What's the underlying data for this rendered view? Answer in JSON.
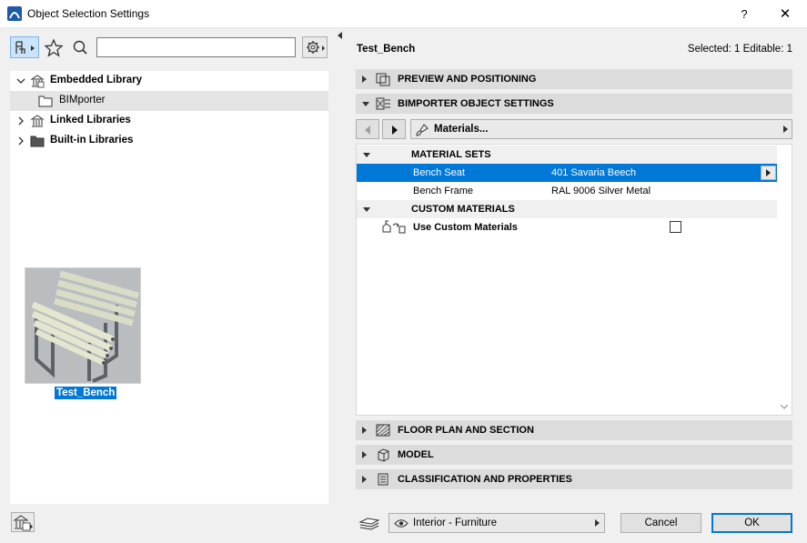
{
  "window": {
    "title": "Object Selection Settings",
    "help_glyph": "?",
    "close_glyph": "✕"
  },
  "library_tree": {
    "items": [
      {
        "label": "Embedded Library",
        "expanded": true,
        "icon": "library-icon"
      },
      {
        "label": "BIMporter",
        "icon": "folder-icon",
        "selected": true
      },
      {
        "label": "Linked Libraries",
        "expanded": false,
        "icon": "library-icon"
      },
      {
        "label": "Built-in Libraries",
        "expanded": false,
        "icon": "folder-filled-icon"
      }
    ]
  },
  "search": {
    "value": "",
    "placeholder": ""
  },
  "preview": {
    "thumbnail_label": "Test_Bench"
  },
  "header": {
    "object_name": "Test_Bench",
    "selection_info": "Selected: 1 Editable: 1"
  },
  "sections": {
    "preview_positioning": "PREVIEW AND POSITIONING",
    "bimporter_settings": "BIMPORTER OBJECT SETTINGS",
    "floor_plan_section": "FLOOR PLAN AND SECTION",
    "model": "MODEL",
    "classification": "CLASSIFICATION AND PROPERTIES"
  },
  "page_nav": {
    "current_page": "Materials..."
  },
  "properties": {
    "material_sets_group": "MATERIAL SETS",
    "rows": [
      {
        "name": "Bench Seat",
        "value": "401 Savaria Beech"
      },
      {
        "name": "Bench Frame",
        "value": "RAL 9006 Silver Metal"
      }
    ],
    "custom_materials_group": "CUSTOM MATERIALS",
    "use_custom_label": "Use Custom Materials",
    "use_custom_checked": false
  },
  "footer": {
    "view_option": "Interior - Furniture",
    "cancel_label": "Cancel",
    "ok_label": "OK"
  },
  "colors": {
    "selection": "#0078d7",
    "section_bg": "#dcdcdc",
    "window_bg": "#f0f0f0"
  }
}
